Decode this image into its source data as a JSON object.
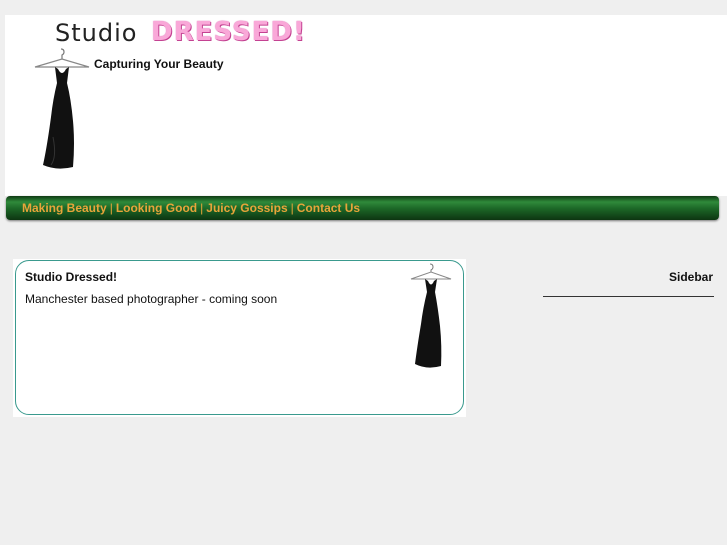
{
  "header": {
    "logo_studio": "Studio",
    "logo_dressed": "DRESSED!",
    "tagline": "Capturing Your Beauty"
  },
  "nav": {
    "items": [
      {
        "label": "Making Beauty"
      },
      {
        "label": "Looking Good"
      },
      {
        "label": "Juicy Gossips"
      },
      {
        "label": "Contact Us"
      }
    ],
    "separator": "|"
  },
  "main": {
    "title": "Studio Dressed!",
    "text": "Manchester based photographer - coming soon"
  },
  "sidebar": {
    "title": "Sidebar"
  },
  "colors": {
    "background": "#efefef",
    "logo_pink": "#f9a8d8",
    "nav_green": "#1d6a28",
    "nav_text": "#e8a43a",
    "box_border": "#3a9a8e"
  },
  "icons": {
    "dress": "black-dress-on-hanger"
  }
}
